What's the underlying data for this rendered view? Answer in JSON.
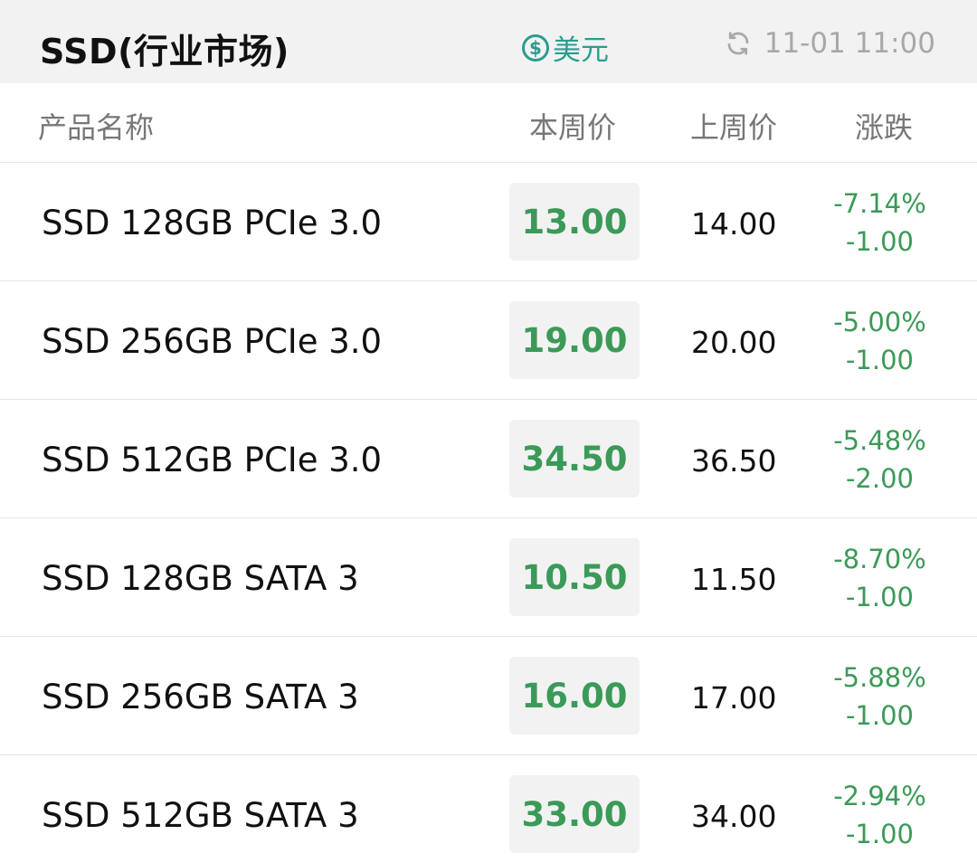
{
  "header": {
    "title": "SSD(行业市场)",
    "currency_label": "美元",
    "timestamp": "11-01 11:00"
  },
  "columns": {
    "name": "产品名称",
    "this_week": "本周价",
    "last_week": "上周价",
    "change": "涨跌"
  },
  "rows": [
    {
      "name": "SSD 128GB PCIe 3.0",
      "this_week": "13.00",
      "last_week": "14.00",
      "change_pct": "-7.14%",
      "change_abs": "-1.00"
    },
    {
      "name": "SSD 256GB PCIe 3.0",
      "this_week": "19.00",
      "last_week": "20.00",
      "change_pct": "-5.00%",
      "change_abs": "-1.00"
    },
    {
      "name": "SSD 512GB PCIe 3.0",
      "this_week": "34.50",
      "last_week": "36.50",
      "change_pct": "-5.48%",
      "change_abs": "-2.00"
    },
    {
      "name": "SSD 128GB SATA 3",
      "this_week": "10.50",
      "last_week": "11.50",
      "change_pct": "-8.70%",
      "change_abs": "-1.00"
    },
    {
      "name": "SSD 256GB SATA 3",
      "this_week": "16.00",
      "last_week": "17.00",
      "change_pct": "-5.88%",
      "change_abs": "-1.00"
    },
    {
      "name": "SSD 512GB SATA 3",
      "this_week": "33.00",
      "last_week": "34.00",
      "change_pct": "-2.94%",
      "change_abs": "-1.00"
    }
  ],
  "icons": {
    "currency": "dollar-circle-icon",
    "refresh": "refresh-icon"
  },
  "colors": {
    "accent_teal": "#2a9d8f",
    "down_green": "#3b9a58",
    "header_bg": "#f2f2f2",
    "muted_text": "#a8a8a8"
  }
}
